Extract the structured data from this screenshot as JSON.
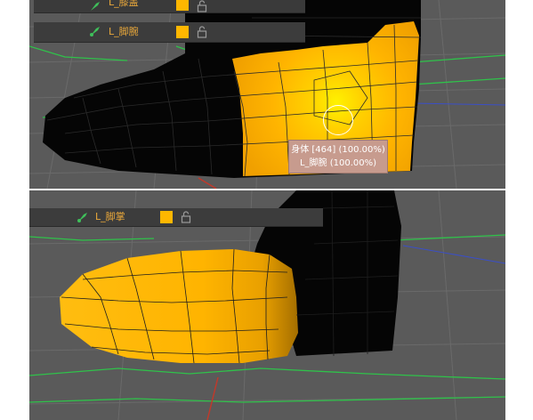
{
  "top_view": {
    "panel": {
      "prev_bone_label": "L_膝盖",
      "bone_label": "L_脚腕",
      "weight_color": "#ffb700"
    },
    "tooltip": {
      "line1": "身体 [464] (100.00%)",
      "line2": "L_脚腕 (100.00%)"
    }
  },
  "bottom_view": {
    "panel": {
      "bone_label": "L_脚掌",
      "weight_color": "#ffb700"
    }
  },
  "icons": {
    "bone": "bone-icon",
    "lock": "unlocked-lock-icon",
    "cursor": "brush-cursor-ring"
  },
  "colors": {
    "viewport_bg": "#5a5a5a",
    "weight_full": "#ffb700",
    "weight_none": "#000000",
    "grid_green": "#2fc24a",
    "axis_red": "#c0392b",
    "axis_blue": "#3b4fc6"
  }
}
